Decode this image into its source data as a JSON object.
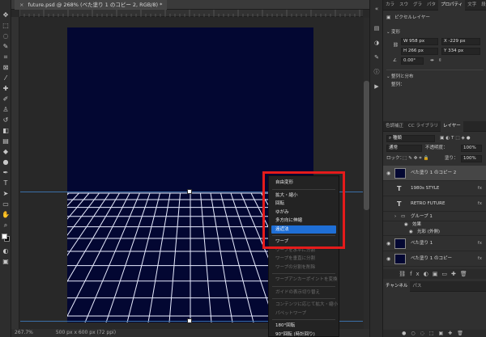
{
  "document": {
    "tab_title": "future.psd @ 268% (べた塗り 1 のコピー 2, RGB/8) *",
    "close_symbol": "×"
  },
  "status": {
    "zoom": "267.7%",
    "size": "500 px x 600 px (72 ppi)"
  },
  "context_menu": {
    "items": [
      {
        "label": "自由変形",
        "enabled": true
      },
      {
        "label": "拡大・縮小",
        "enabled": true
      },
      {
        "label": "回転",
        "enabled": true
      },
      {
        "label": "ゆがみ",
        "enabled": true
      },
      {
        "label": "多方向に伸縮",
        "enabled": true
      },
      {
        "label": "遠近法",
        "enabled": true,
        "selected": true
      },
      {
        "label": "ワープ",
        "enabled": true
      },
      {
        "label": "ワープを水平に分割",
        "enabled": false
      },
      {
        "label": "ワープを垂直に分割",
        "enabled": false
      },
      {
        "label": "ワープの分割を削除",
        "enabled": false
      },
      {
        "label": "ワープアンカーポイントを変換",
        "enabled": false
      },
      {
        "label": "ガイドの表示切り替え",
        "enabled": false
      },
      {
        "label": "コンテンツに応じて拡大・縮小",
        "enabled": false
      },
      {
        "label": "パペットワープ",
        "enabled": false
      },
      {
        "label": "180°回転",
        "enabled": true
      },
      {
        "label": "90°回転 (時計回り)",
        "enabled": true
      }
    ]
  },
  "properties_panel": {
    "tabs": [
      "カラ",
      "スウ",
      "グラ",
      "パタ",
      "プロパティ",
      "文字",
      "段落"
    ],
    "active_tab": "プロパティ",
    "layer_kind": "ピクセルレイヤー",
    "transform_heading": "変形",
    "w": "W 958 px",
    "x": "X  -229 px",
    "h": "H 266 px",
    "y": "Y  334 px",
    "angle": "0.00°",
    "align_heading": "整列と分布",
    "align_label": "整列："
  },
  "layers_panel": {
    "tabs": [
      "色調補正",
      "CC ライブラリ",
      "レイヤー"
    ],
    "active_tab": "レイヤー",
    "filter_kind": "種類",
    "blend_mode": "通常",
    "opacity_label": "不透明度：",
    "opacity": "100%",
    "lock_label": "ロック：",
    "fill_label": "塗り：",
    "fill": "100%",
    "layers": [
      {
        "name": "べた塗り 1 のコピー 2",
        "type": "pixel",
        "selected": true,
        "visible": true,
        "fx": ""
      },
      {
        "name": "1980s STYLE",
        "type": "text",
        "selected": false,
        "visible": false,
        "fx": "fx"
      },
      {
        "name": "RETRO FUTURE",
        "type": "text",
        "selected": false,
        "visible": false,
        "fx": "fx"
      },
      {
        "name": "グループ 1",
        "type": "group",
        "selected": false,
        "visible": false,
        "fx": ""
      },
      {
        "name": "効果",
        "type": "effect",
        "selected": false,
        "visible": false,
        "fx": ""
      },
      {
        "name": "光彩 (外側)",
        "type": "effect",
        "selected": false,
        "visible": false,
        "fx": ""
      },
      {
        "name": "べた塗り 1",
        "type": "pixel",
        "selected": false,
        "visible": true,
        "fx": "fx"
      },
      {
        "name": "べた塗り 1 のコピー",
        "type": "pixel",
        "selected": false,
        "visible": true,
        "fx": "fx"
      }
    ]
  },
  "channels_panel": {
    "tabs": [
      "チャンネル",
      "パス"
    ]
  },
  "colors": {
    "canvas": "#030732",
    "menu_highlight": "#1f6fd6",
    "annotation_box": "#e51b1b"
  }
}
